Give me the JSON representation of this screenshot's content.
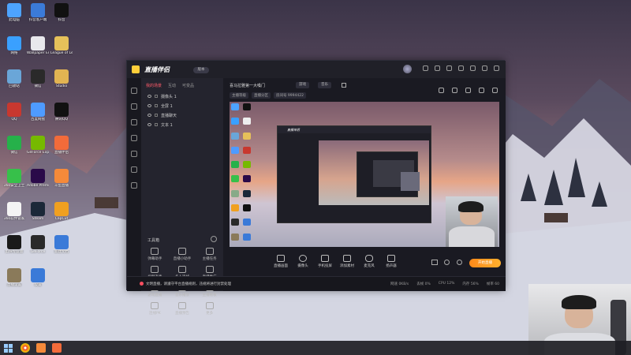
{
  "desktop": {
    "icons": [
      {
        "label": "此电脑",
        "color": "#4da3ff"
      },
      {
        "label": "抖音客户端",
        "color": "#3b7bd8"
      },
      {
        "label": "抖音",
        "color": "#111111"
      },
      {
        "label": "网络",
        "color": "#3aa0ff"
      },
      {
        "label": "Wallpaper Engine",
        "color": "#e8e8ec"
      },
      {
        "label": "League of Legends",
        "color": "#e6c15a"
      },
      {
        "label": "回收站",
        "color": "#6aa6d8"
      },
      {
        "label": "微信",
        "color": "#2a2a2a"
      },
      {
        "label": "Studio",
        "color": "#e2b452"
      },
      {
        "label": "QQ",
        "color": "#c8382f"
      },
      {
        "label": "百度网盘",
        "color": "#4e9bff"
      },
      {
        "label": "腾讯QQ",
        "color": "#111111"
      },
      {
        "label": "微信",
        "color": "#26b14a"
      },
      {
        "label": "GeForce Experience",
        "color": "#76b900"
      },
      {
        "label": "直播伴侣",
        "color": "#f26b3a"
      },
      {
        "label": "360安全卫士",
        "color": "#37c04a"
      },
      {
        "label": "Adobe Premiere",
        "color": "#2a0a49"
      },
      {
        "label": "斗鱼直播",
        "color": "#f58a3a"
      },
      {
        "label": "360软件管家",
        "color": "#f4f4f4"
      },
      {
        "label": "Steam",
        "color": "#1b2838"
      },
      {
        "label": "CapCut",
        "color": "#f0a020"
      },
      {
        "label": "剪映专业版",
        "color": "#1a1a1a"
      },
      {
        "label": "GeForce",
        "color": "#2a2a2a"
      },
      {
        "label": "新建文档",
        "color": "#3a7ad8"
      },
      {
        "label": "直播设置",
        "color": "#8a7a5a"
      },
      {
        "label": "设置",
        "color": "#3a7ad8"
      }
    ]
  },
  "window": {
    "app_name": "直播伴侣",
    "version_badge": "版本",
    "scene_tabs": [
      "我的场景",
      "互动",
      "可变品"
    ],
    "sources": [
      "摄像头 1",
      "全屏 1",
      "直播聊天",
      "文本 1"
    ],
    "tools_title": "工具箱",
    "tools": [
      "弹幕助手",
      "直播小助手",
      "主播任务",
      "视频连麦",
      "多人连线",
      "直播推广",
      "游戏直播",
      "音乐播放",
      "主播看板",
      "连线PK",
      "直播预告",
      "更多"
    ],
    "room": {
      "title": "喜马拉雅第一大嗓门",
      "tag1": "游戏",
      "tag2": "音乐",
      "meta": [
        "主播等级",
        "直播分区",
        "房间号 9994422"
      ]
    },
    "controls": [
      "直播画面",
      "摄像头",
      "手机投屏",
      "添加素材",
      "麦克风",
      "扬声器"
    ],
    "start_button": "开始直播",
    "status_message": "文明直播，请遵守平台直播规则，违规将进行封禁处理",
    "stats": [
      "网速 0KB/s",
      "丢帧 0%",
      "CPU 12%",
      "内存 56%",
      "帧率 60"
    ]
  },
  "colors": {
    "accent": "#ff5b6a",
    "start": "#ff9a22"
  }
}
